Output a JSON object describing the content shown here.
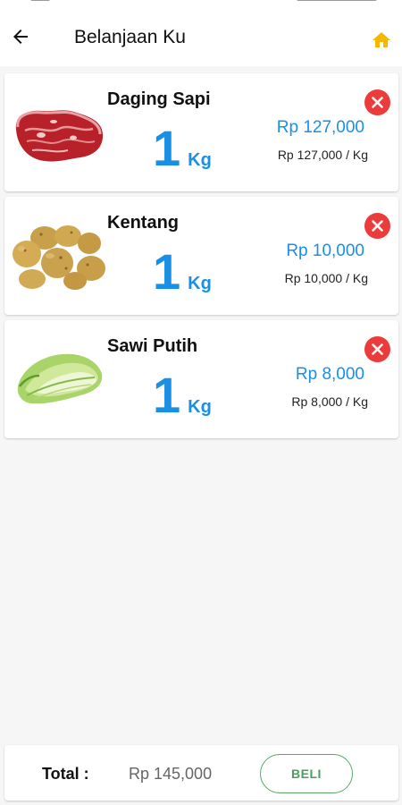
{
  "app": {
    "title": "Belanjaan Ku",
    "back_icon": "arrow-left-icon",
    "home_icon": "home-icon",
    "accent_color": "#1a8fe6",
    "home_color": "#f5b800",
    "remove_color": "#ec3b3b"
  },
  "cart": {
    "items": [
      {
        "name": "Daging Sapi",
        "qty": "1",
        "unit": "Kg",
        "price": "Rp 127,000",
        "unit_price": "Rp 127,000 / Kg",
        "image": "beef-steak-image"
      },
      {
        "name": "Kentang",
        "qty": "1",
        "unit": "Kg",
        "price": "Rp 10,000",
        "unit_price": "Rp 10,000 / Kg",
        "image": "potatoes-image"
      },
      {
        "name": "Sawi Putih",
        "qty": "1",
        "unit": "Kg",
        "price": "Rp 8,000",
        "unit_price": "Rp 8,000 / Kg",
        "image": "napa-cabbage-image"
      }
    ]
  },
  "footer": {
    "total_label": "Total :",
    "total_value": "Rp 145,000",
    "buy_label": "BELI",
    "buy_color": "#4a9e5c"
  }
}
